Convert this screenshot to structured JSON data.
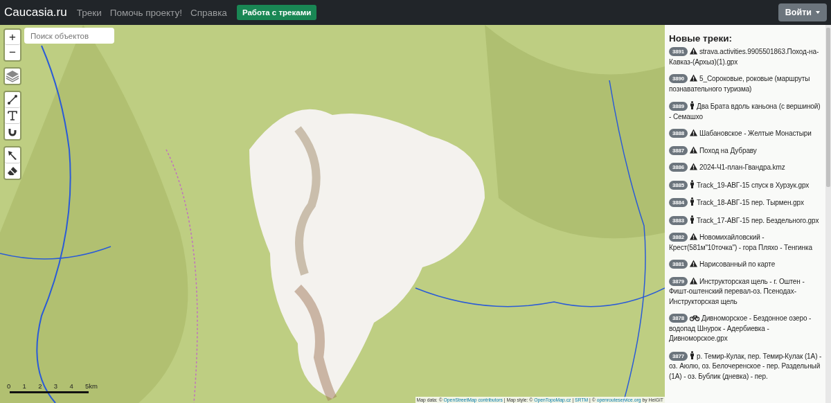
{
  "navbar": {
    "brand": "Caucasia.ru",
    "links": [
      {
        "label": "Треки"
      },
      {
        "label": "Помочь проекту!"
      },
      {
        "label": "Справка"
      }
    ],
    "action_button": "Работа с треками",
    "login_button": "Войти"
  },
  "map": {
    "search": {
      "placeholder": "Поиск объектов"
    },
    "zoom_controls": [
      "+",
      "−"
    ],
    "tools": [
      {
        "kind": "layers"
      },
      {
        "kind": "line"
      },
      {
        "kind": "text"
      },
      {
        "kind": "magnet"
      },
      {
        "kind": "pointer"
      },
      {
        "kind": "eraser"
      }
    ],
    "scale": [
      "0",
      "1",
      "2",
      "3",
      "4",
      "5km"
    ],
    "attribution": [
      {
        "text": "Map data: © ",
        "kind": "plain"
      },
      {
        "text": "OpenStreetMap contributors",
        "kind": "link"
      },
      {
        "text": " | Map style: © ",
        "kind": "plain"
      },
      {
        "text": "OpenTopoMap.cz",
        "kind": "link"
      },
      {
        "text": " | ",
        "kind": "plain"
      },
      {
        "text": "SRTM",
        "kind": "link"
      },
      {
        "text": " | © ",
        "kind": "plain"
      },
      {
        "text": "openrouteservice.org",
        "kind": "link"
      },
      {
        "text": " by HeiGIT",
        "kind": "plain"
      }
    ]
  },
  "sidebar": {
    "title": "Новые треки:",
    "tracks": [
      {
        "id": "3891",
        "kind": "warning",
        "name": "strava.activities.9905501863.Поход-на-Кавказ-(Архыз)(1).gpx"
      },
      {
        "id": "3890",
        "kind": "warning",
        "name": "5_Сороковые, роковые (маршруты познавательного туризма)"
      },
      {
        "id": "3889",
        "kind": "hike",
        "name": "Два Брата вдоль каньона (с вершиной) - Семашхо"
      },
      {
        "id": "3888",
        "kind": "warning",
        "name": "Шабановское - Желтые Монастыри"
      },
      {
        "id": "3887",
        "kind": "warning",
        "name": "Поход на Дубраву"
      },
      {
        "id": "3886",
        "kind": "warning",
        "name": "2024-Ч1-план-Гвандра.kmz"
      },
      {
        "id": "3885",
        "kind": "hike",
        "name": "Track_19-АВГ-15 спуск в Хурзук.gpx"
      },
      {
        "id": "3884",
        "kind": "hike",
        "name": "Track_18-АВГ-15 пер. Тырмен.gpx"
      },
      {
        "id": "3883",
        "kind": "hike",
        "name": "Track_17-АВГ-15 пер. Бездельного.gpx"
      },
      {
        "id": "3882",
        "kind": "warning",
        "name": "Новомихайловский - Крест(581м\"10точка\") - гора Пляхо - Тенгинка"
      },
      {
        "id": "3881",
        "kind": "warning",
        "name": "Нарисованный по карте"
      },
      {
        "id": "3879",
        "kind": "warning",
        "name": "Инструкторская щель - г. Оштен - Фишт-оштенский перевал-оз. Псенодах-Инструкторская щель"
      },
      {
        "id": "3878",
        "kind": "bike",
        "name": "Дивноморское - Бездонное озеро - водопад Шнурок - Адербиевка - Дивноморское.gpx"
      },
      {
        "id": "3877",
        "kind": "hike",
        "name": "р. Темир-Кулак, пер. Темир-Кулак (1А) - оз. Аюлю, оз. Белочеренское - пер. Раздельный (1А) - оз. Бублик (дневка) - пер."
      }
    ]
  }
}
